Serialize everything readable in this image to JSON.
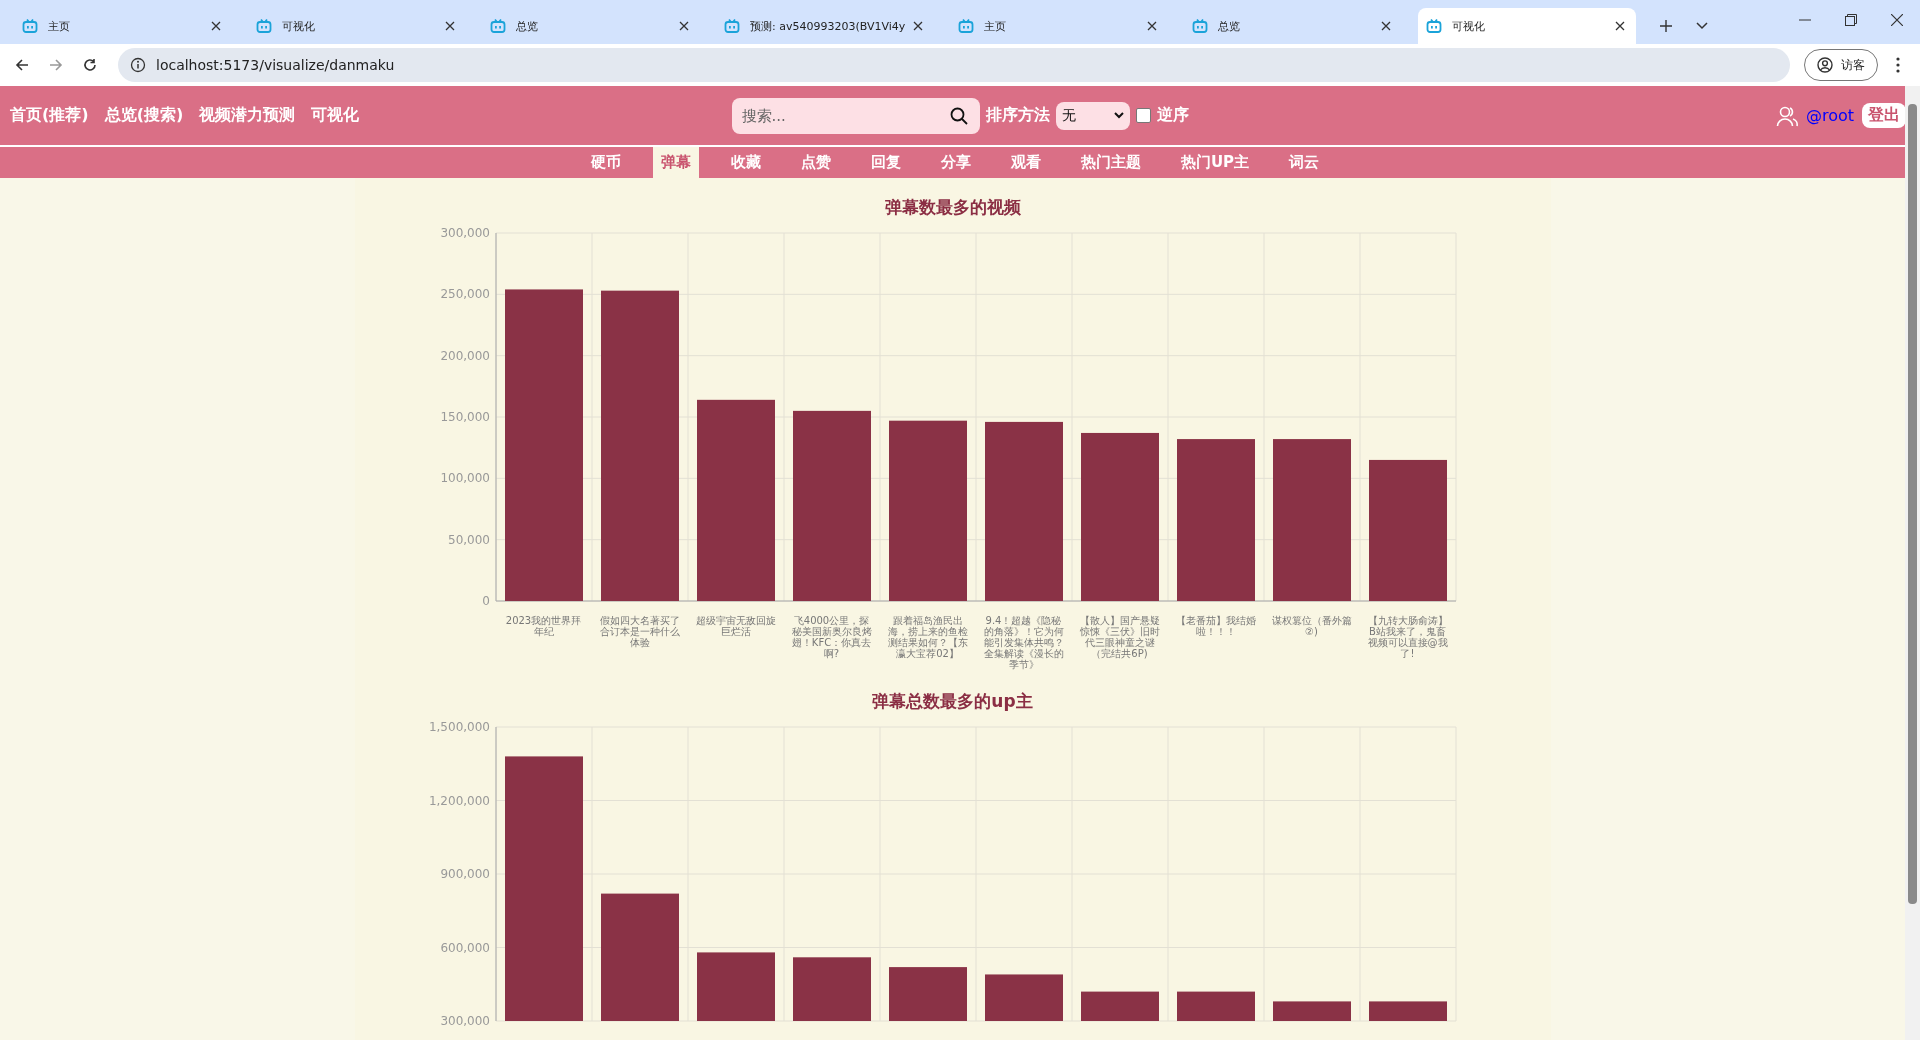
{
  "browser": {
    "tabs": [
      {
        "title": "主页",
        "selected": false
      },
      {
        "title": "可视化",
        "selected": false
      },
      {
        "title": "总览",
        "selected": false
      },
      {
        "title": "预测: av540993203(BV1Vi4y",
        "selected": false
      },
      {
        "title": "主页",
        "selected": false
      },
      {
        "title": "总览",
        "selected": false
      },
      {
        "title": "可视化",
        "selected": true
      }
    ],
    "address": "localhost:5173/visualize/danmaku",
    "profile": "访客"
  },
  "nav": {
    "links": [
      "首页(推荐)",
      "总览(搜索)",
      "视频潜力预测",
      "可视化"
    ],
    "search": {
      "placeholder": "搜索..."
    },
    "sort_label": "排序方法",
    "sort_value": "无",
    "reverse": {
      "label": "逆序",
      "checked": false
    },
    "user": "@root",
    "logout": "登出"
  },
  "subnav": [
    {
      "label": "硬币",
      "selected": false
    },
    {
      "label": "弹幕",
      "selected": true
    },
    {
      "label": "收藏",
      "selected": false
    },
    {
      "label": "点赞",
      "selected": false
    },
    {
      "label": "回复",
      "selected": false
    },
    {
      "label": "分享",
      "selected": false
    },
    {
      "label": "观看",
      "selected": false
    },
    {
      "label": "热门主题",
      "selected": false
    },
    {
      "label": "热门UP主",
      "selected": false
    },
    {
      "label": "词云",
      "selected": false
    }
  ],
  "charts": [
    {
      "chart_data": {
        "type": "bar",
        "title": "弹幕数最多的视频",
        "categories": [
          "2023我的世界拜年纪",
          "假如四大名著买了合订本是一种什么体验",
          "超级宇宙无敌回旋巨烂活",
          "飞4000公里，探秘美国新奥尔良烤翅！KFC：你真去啊?",
          "跟着福岛渔民出海，捞上来的鱼检测结果如何？【东瀛大宝荐02】",
          "9.4！超越《隐秘的角落》！它为何能引发集体共鸣？全集解读《漫长的季节》",
          "【散人】国产悬疑惊悚《三伏》旧时代三眼神童之谜（完结共6P)",
          "【老番茄】我结婚啦！！！",
          "谋权篡位（番外篇②)",
          "【九转大肠俞涛】B站我来了，鬼畜视频可以直接@我了!"
        ],
        "series": [
          {
            "color": "#8a3246",
            "values": [
              254000,
              253000,
              164000,
              155000,
              147000,
              146000,
              137000,
              132000,
              132000,
              115000
            ]
          }
        ],
        "ylim": [
          0,
          300000
        ],
        "grid": true,
        "yticks": [
          {
            "value": 0,
            "label": "0"
          },
          {
            "value": 50000,
            "label": "50,000"
          },
          {
            "value": 100000,
            "label": "100,000"
          },
          {
            "value": 150000,
            "label": "150,000"
          },
          {
            "value": 200000,
            "label": "200,000"
          },
          {
            "value": 250000,
            "label": "250,000"
          },
          {
            "value": 300000,
            "label": "300,000"
          }
        ]
      }
    },
    {
      "chart_data": {
        "type": "bar",
        "title": "弹幕总数最多的up主",
        "series": [
          {
            "color": "#8a3246",
            "values": [
              1380000,
              820000,
              580000,
              560000,
              520000,
              490000,
              420000,
              420000,
              380000,
              380000
            ]
          }
        ],
        "ylim": [
          300000,
          1500000
        ],
        "grid": true,
        "yticks": [
          {
            "value": 300000,
            "label": "300,000"
          },
          {
            "value": 600000,
            "label": "600,000"
          },
          {
            "value": 900000,
            "label": "900,000"
          },
          {
            "value": 1200000,
            "label": "1,200,000"
          },
          {
            "value": 1500000,
            "label": "1,500,000"
          }
        ]
      }
    }
  ]
}
